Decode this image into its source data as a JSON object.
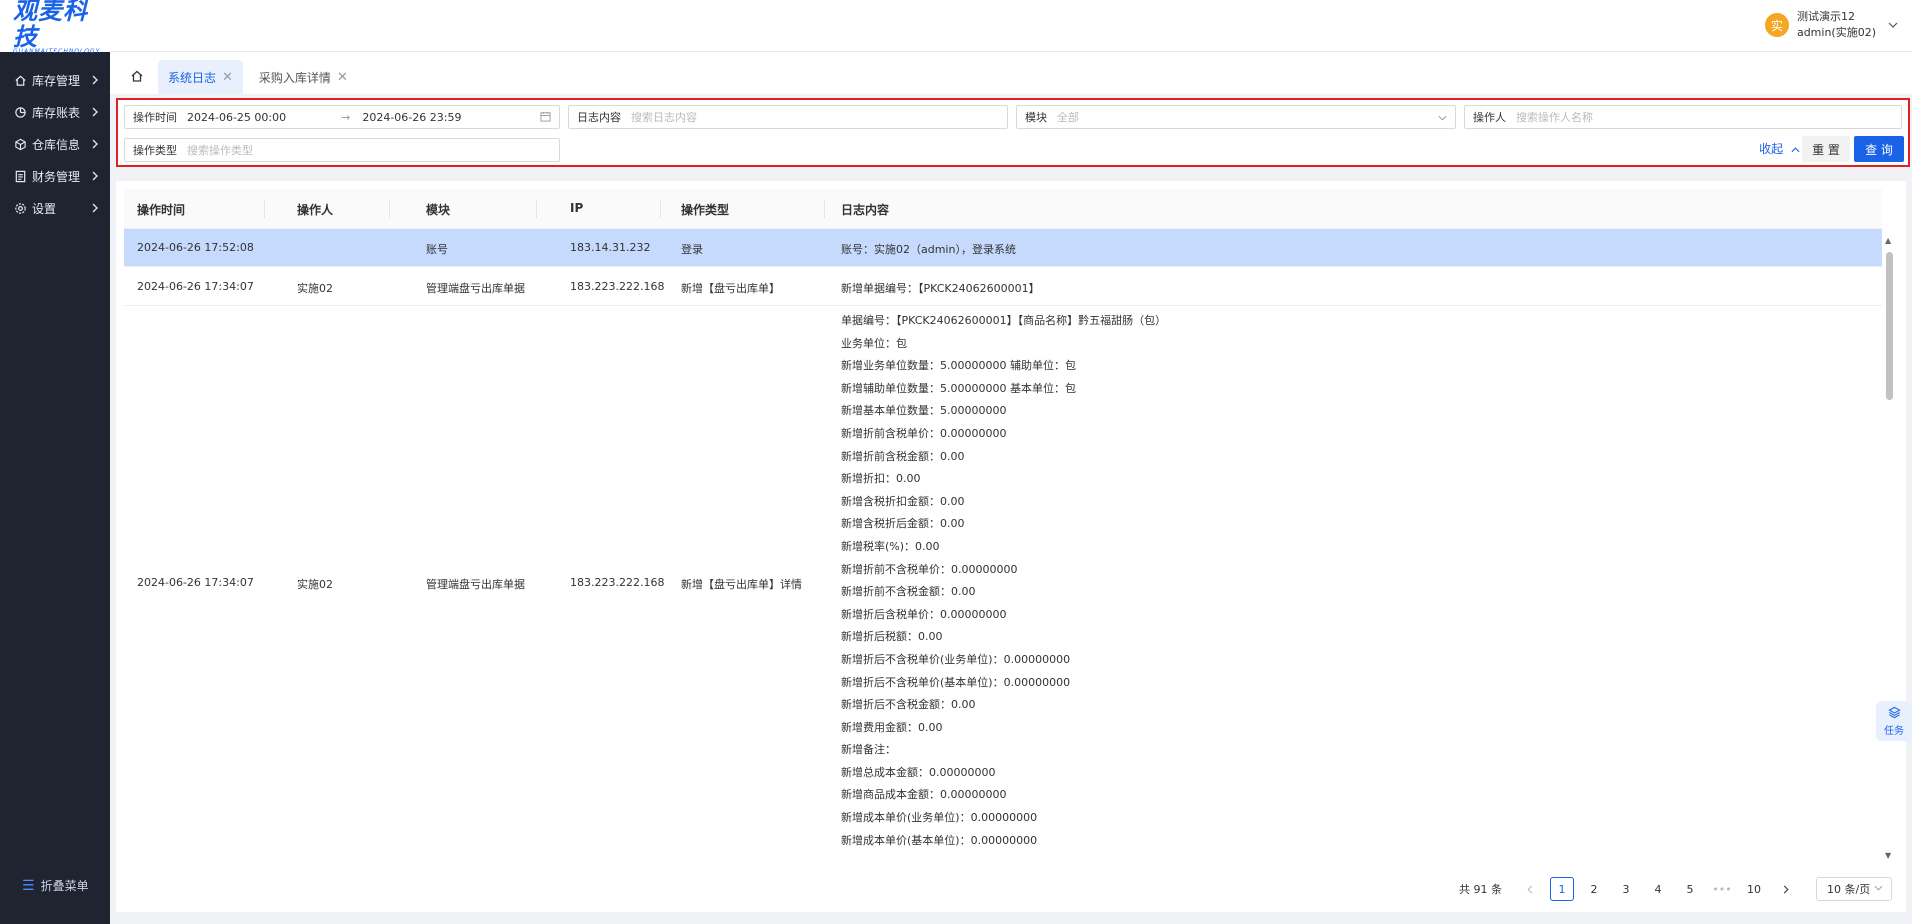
{
  "brand": {
    "logo_text": "观麦科技",
    "logo_sub": "GUANMAITECHNOLOGY"
  },
  "sidebar": {
    "items": [
      {
        "label": "库存管理",
        "icon": "home-icon"
      },
      {
        "label": "库存账表",
        "icon": "chart-icon"
      },
      {
        "label": "仓库信息",
        "icon": "cube-icon"
      },
      {
        "label": "财务管理",
        "icon": "ledger-icon"
      },
      {
        "label": "设置",
        "icon": "gear-icon"
      }
    ],
    "collapse_label": "折叠菜单"
  },
  "header": {
    "avatar_text": "实",
    "user_name": "测试演示12",
    "user_account": "admin(实施02)"
  },
  "tabs": [
    {
      "label": "系统日志",
      "active": true
    },
    {
      "label": "采购入库详情",
      "active": false
    }
  ],
  "filters": {
    "time_label": "操作时间",
    "time_start": "2024-06-25 00:00",
    "time_end": "2024-06-26 23:59",
    "log_label": "日志内容",
    "log_placeholder": "搜索日志内容",
    "module_label": "模块",
    "module_value": "全部",
    "operator_label": "操作人",
    "operator_placeholder": "搜索操作人名称",
    "type_label": "操作类型",
    "type_placeholder": "搜索操作类型",
    "collapse_label": "收起",
    "reset_label": "重 置",
    "query_label": "查 询"
  },
  "table": {
    "columns": [
      "操作时间",
      "操作人",
      "模块",
      "IP",
      "操作类型",
      "日志内容"
    ],
    "rows": [
      {
        "time": "2024-06-26 17:52:08",
        "operator": "",
        "module": "账号",
        "ip": "183.14.31.232",
        "type": "登录",
        "log": [
          "账号：实施02（admin），登录系统"
        ]
      },
      {
        "time": "2024-06-26 17:34:07",
        "operator": "实施02",
        "module": "管理端盘亏出库单据",
        "ip": "183.223.222.168",
        "type": "新增【盘亏出库单】",
        "log": [
          "新增单据编号：【PKCK24062600001】"
        ]
      },
      {
        "time": "2024-06-26 17:34:07",
        "operator": "实施02",
        "module": "管理端盘亏出库单据",
        "ip": "183.223.222.168",
        "type": "新增【盘亏出库单】详情",
        "log": [
          "单据编号：【PKCK24062600001】【商品名称】黔五福甜肠（包）",
          "业务单位：包",
          "新增业务单位数量：5.00000000 辅助单位：包",
          "新增辅助单位数量：5.00000000 基本单位：包",
          "新增基本单位数量：5.00000000",
          "新增折前含税单价：0.00000000",
          "新增折前含税金额：0.00",
          "新增折扣：0.00",
          "新增含税折扣金额：0.00",
          "新增含税折后金额：0.00",
          "新增税率(%)：0.00",
          "新增折前不含税单价：0.00000000",
          "新增折前不含税金额：0.00",
          "新增折后含税单价：0.00000000",
          "新增折后税额：0.00",
          "新增折后不含税单价(业务单位)：0.00000000",
          "新增折后不含税单价(基本单位)：0.00000000",
          "新增折后不含税金额：0.00",
          "新增费用金额：0.00",
          "新增备注：",
          "新增总成本金额：0.00000000",
          "新增商品成本金额：0.00000000",
          "新增成本单价(业务单位)：0.00000000",
          "新增成本单价(基本单位)：0.00000000"
        ]
      }
    ]
  },
  "task_float": {
    "label": "任务",
    "icon": "layers-icon"
  },
  "pagination": {
    "total_text": "共 91 条",
    "pages": [
      "1",
      "2",
      "3",
      "4",
      "5",
      "•••",
      "10"
    ],
    "current": "1",
    "page_size": "10 条/页"
  },
  "colors": {
    "accent": "#1a62e8",
    "selected_row": "#c5dafc",
    "sidebar_bg": "#1f2430",
    "highlight_border": "#e02020"
  }
}
